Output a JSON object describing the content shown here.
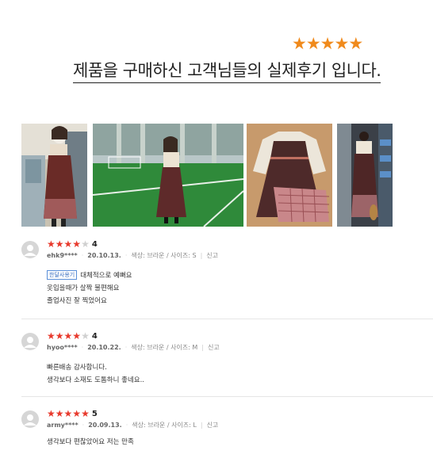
{
  "hero": {
    "stars": [
      "★",
      "★",
      "★",
      "★",
      "★"
    ],
    "headline": "제품을 구매하신 고객님들의 실제후기 입니다."
  },
  "gallery": {
    "photos": [
      "review-photo-1",
      "review-photo-2",
      "review-photo-3",
      "review-photo-4"
    ]
  },
  "reviews": [
    {
      "rating": 4,
      "score": "4",
      "user": "ehk9****",
      "date": "20.10.13.",
      "option": "색상: 브라운 / 사이즈: S",
      "report": "신고",
      "badge": "한달사용기",
      "lines": [
        "대체적으로 예뻐요",
        "옷입을때가 살짝 불편해요",
        "졸업사진 잘 찍었어요"
      ]
    },
    {
      "rating": 4,
      "score": "4",
      "user": "hyoo****",
      "date": "20.10.22.",
      "option": "색상: 브라운 / 사이즈: M",
      "report": "신고",
      "lines": [
        "빠른배송 감사합니다.",
        "생각보다 소재도 도톰하니 좋네요.."
      ]
    },
    {
      "rating": 5,
      "score": "5",
      "user": "army****",
      "date": "20.09.13.",
      "option": "색상: 브라운 / 사이즈: L",
      "report": "신고",
      "lines": [
        "생각보다 편찮았어요 저는 만족"
      ]
    }
  ],
  "colors": {
    "accent_star": "#f08a1c",
    "rating_star": "#e8392c",
    "badge": "#3a6fc0"
  }
}
